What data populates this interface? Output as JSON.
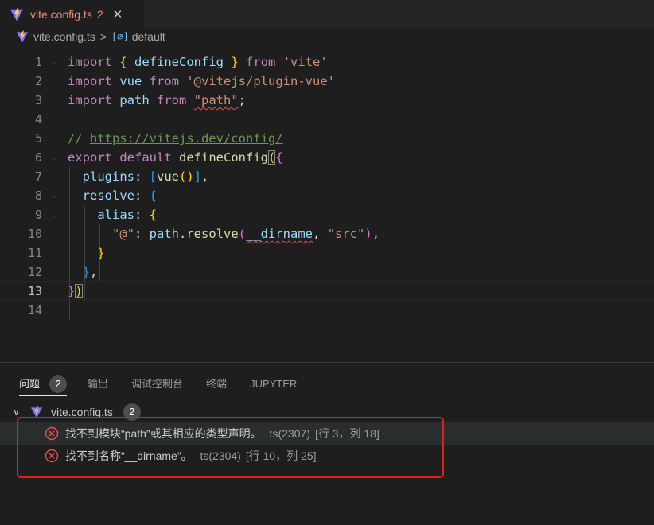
{
  "tab": {
    "title": "vite.config.ts",
    "problem_count": "2",
    "close": "✕"
  },
  "breadcrumb": {
    "file": "vite.config.ts",
    "separator": ">",
    "symbol_glyph": "[∅]",
    "symbol": "default"
  },
  "editor": {
    "line_numbers": [
      "1",
      "2",
      "3",
      "4",
      "5",
      "6",
      "7",
      "8",
      "9",
      "10",
      "11",
      "12",
      "13",
      "14"
    ],
    "current_line": "13",
    "code": {
      "l1": [
        "import",
        " ",
        "{",
        " defineConfig ",
        "}",
        " from ",
        "'vite'"
      ],
      "l2": [
        "import",
        " vue ",
        "from",
        " ",
        "'@vitejs/plugin-vue'"
      ],
      "l3": [
        "import",
        " path ",
        "from",
        " ",
        "\"path\"",
        ";"
      ],
      "l5": [
        "// ",
        "https://vitejs.dev/config/"
      ],
      "l6": [
        "export",
        " ",
        "default",
        " ",
        "defineConfig",
        "(",
        "{"
      ],
      "l7": [
        "plugins",
        ": ",
        "[",
        "vue",
        "()",
        "]",
        ","
      ],
      "l8": [
        "resolve",
        ": ",
        "{"
      ],
      "l9": [
        "alias",
        ": ",
        "{"
      ],
      "l10": [
        "\"@\"",
        ": ",
        "path",
        ".",
        "resolve",
        "(",
        "__dirname",
        ", ",
        "\"src\"",
        ")",
        ","
      ],
      "l11": [
        "}"
      ],
      "l12": [
        "}",
        ","
      ],
      "l13": [
        "}",
        ")"
      ]
    }
  },
  "panel": {
    "tabs": [
      {
        "label": "问题",
        "count": "2",
        "active": true
      },
      {
        "label": "输出"
      },
      {
        "label": "调试控制台"
      },
      {
        "label": "终端"
      },
      {
        "label": "JUPYTER"
      }
    ],
    "group": {
      "chevron": "∨",
      "file": "vite.config.ts",
      "count": "2"
    },
    "problems": [
      {
        "message": "找不到模块“path”或其相应的类型声明。",
        "source": "ts(2307)",
        "location": "[行 3，列 18]"
      },
      {
        "message": "找不到名称“__dirname”。",
        "source": "ts(2304)",
        "location": "[行 10，列 25]"
      }
    ]
  },
  "colors": {
    "background": "#1e1e1e",
    "error": "#f14c4c",
    "annotation_box": "#e0211b",
    "keyword": "#c586c0",
    "string": "#ce9178",
    "variable": "#9cdcfe",
    "function": "#dcdcaa",
    "comment": "#6a9955"
  },
  "icons": {
    "file": "vite-logo-icon",
    "symbol": "symbol-variable-icon",
    "error": "error-circle-icon",
    "close": "close-icon",
    "chevron": "chevron-down-icon"
  }
}
